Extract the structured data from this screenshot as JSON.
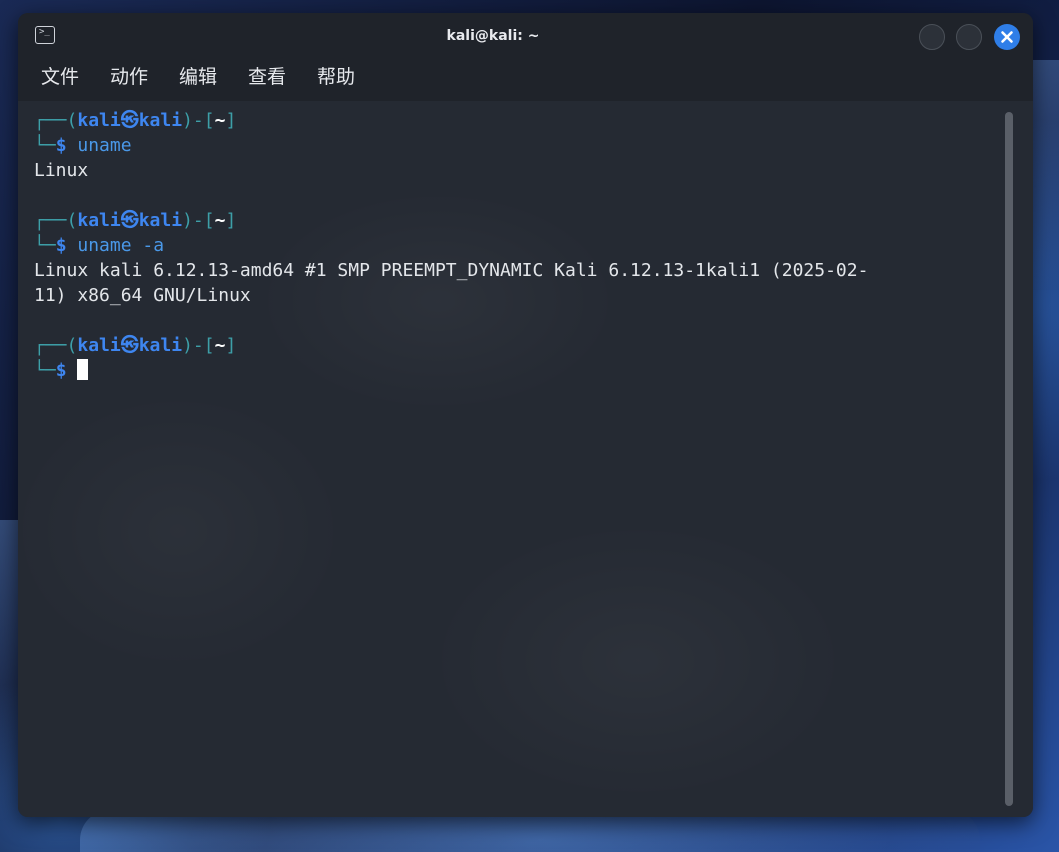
{
  "window": {
    "title": "kali@kali: ~",
    "icon": "terminal-icon",
    "close_icon": "close-icon",
    "accent_color": "#2f7ee8"
  },
  "menu": {
    "items": [
      "文件",
      "动作",
      "编辑",
      "查看",
      "帮助"
    ]
  },
  "prompt": {
    "box_top": "┌──(",
    "user": "kali",
    "at_symbol": "㉿",
    "host": "kali",
    "mid": ")-[",
    "dir": "~",
    "close": "]",
    "box_bottom": "└─",
    "dollar": "$",
    "user_color": "#3e86f0",
    "box_color": "#3d9fa8"
  },
  "session": {
    "cmd1": "uname",
    "out1": "Linux",
    "cmd2": "uname -a",
    "out2_line1": "Linux kali 6.12.13-amd64 #1 SMP PREEMPT_DYNAMIC Kali 6.12.13-1kali1 (2025-02-",
    "out2_line2": "11) x86_64 GNU/Linux"
  }
}
